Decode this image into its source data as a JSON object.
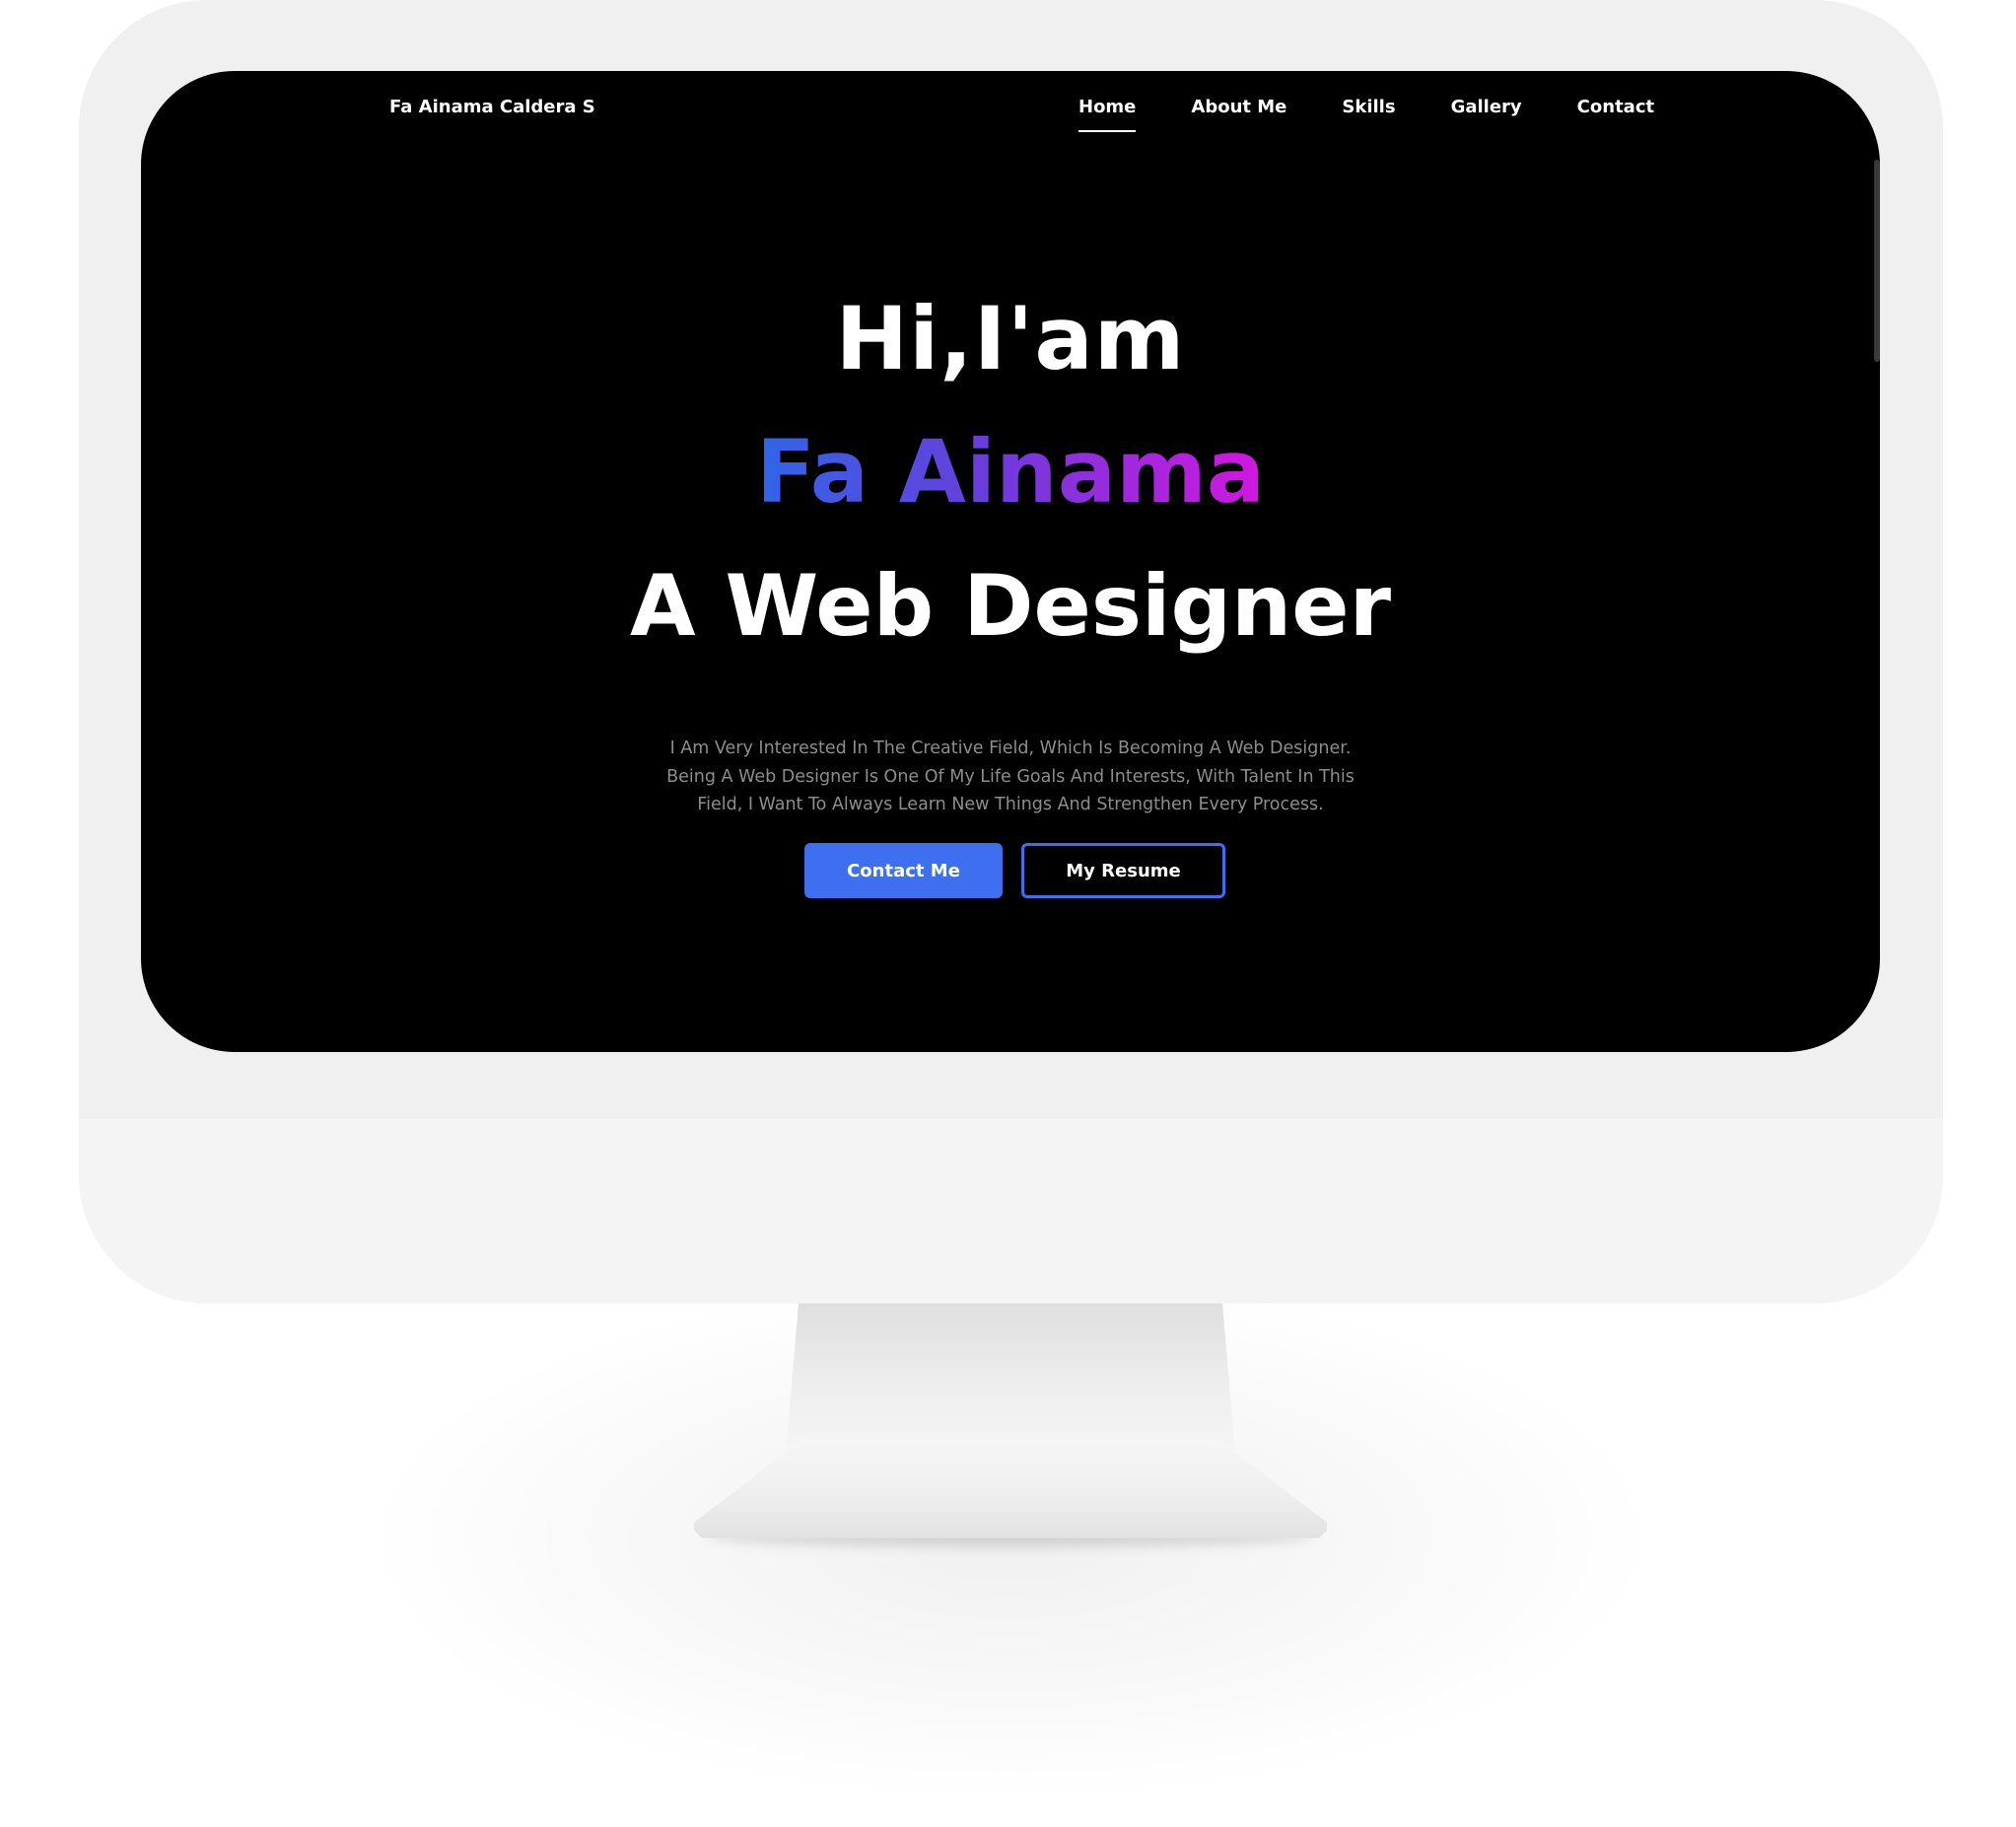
{
  "site": {
    "brand": "Fa Ainama Caldera S"
  },
  "nav": {
    "items": [
      {
        "label": "Home",
        "active": true
      },
      {
        "label": "About Me",
        "active": false
      },
      {
        "label": "Skills",
        "active": false
      },
      {
        "label": "Gallery",
        "active": false
      },
      {
        "label": "Contact",
        "active": false
      }
    ]
  },
  "hero": {
    "greeting": "Hi,I'am",
    "name": "Fa Ainama",
    "role": "A Web Designer",
    "description_lines": [
      "I Am Very Interested In The Creative Field, Which Is Becoming A Web Designer.",
      "Being A Web Designer Is One Of My Life Goals And Interests, With Talent In This",
      "Field, I Want To Always Learn New Things And Strengthen Every Process."
    ],
    "primary_button": "Contact Me",
    "secondary_button": "My Resume"
  },
  "colors": {
    "screen_background": "#000000",
    "accent": "#3d6ff0",
    "gradient_start": "#2f66e8",
    "gradient_end": "#d316e0",
    "description_text": "#8d8d8d"
  }
}
